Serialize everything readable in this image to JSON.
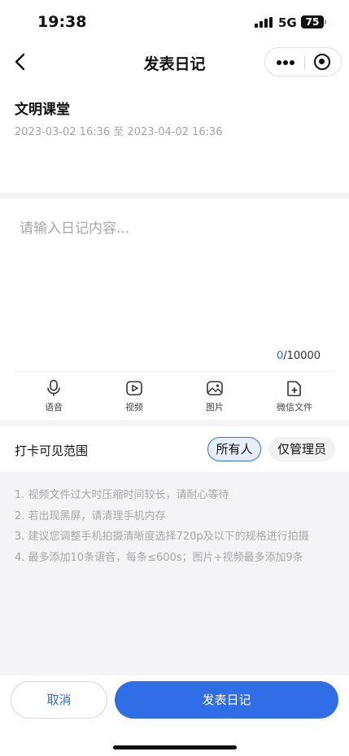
{
  "status_bar": {
    "time": "19:38",
    "network": "5G",
    "battery": "75"
  },
  "nav": {
    "title": "发表日记"
  },
  "course": {
    "name": "文明课堂",
    "start": "2023-03-02 16:36",
    "separator": "至",
    "end": "2023-04-02 16:36"
  },
  "editor": {
    "placeholder": "请输入日记内容...",
    "count": "0",
    "max": "/10000"
  },
  "toolbar": [
    {
      "label": "语音",
      "icon": "microphone-icon"
    },
    {
      "label": "视频",
      "icon": "video-icon"
    },
    {
      "label": "图片",
      "icon": "image-icon"
    },
    {
      "label": "微信文件",
      "icon": "file-add-icon"
    }
  ],
  "visibility": {
    "label": "打卡可见范围",
    "options": [
      "所有人",
      "仅管理员"
    ],
    "selected": "所有人"
  },
  "tips": [
    "1. 视频文件过大时压缩时间较长，请耐心等待",
    "2. 若出现黑屏，请清理手机内存",
    "3. 建议您调整手机拍摄清晰度选择720p及以下的规格进行拍摄",
    "4. 最多添加10条语音，每条≤600s；图片+视频最多添加9条"
  ],
  "actions": {
    "cancel": "取消",
    "publish": "发表日记"
  },
  "colors": {
    "accent": "#2f6ee6",
    "tip_text": "#a7a7a7",
    "background": "#f4f4f6"
  }
}
